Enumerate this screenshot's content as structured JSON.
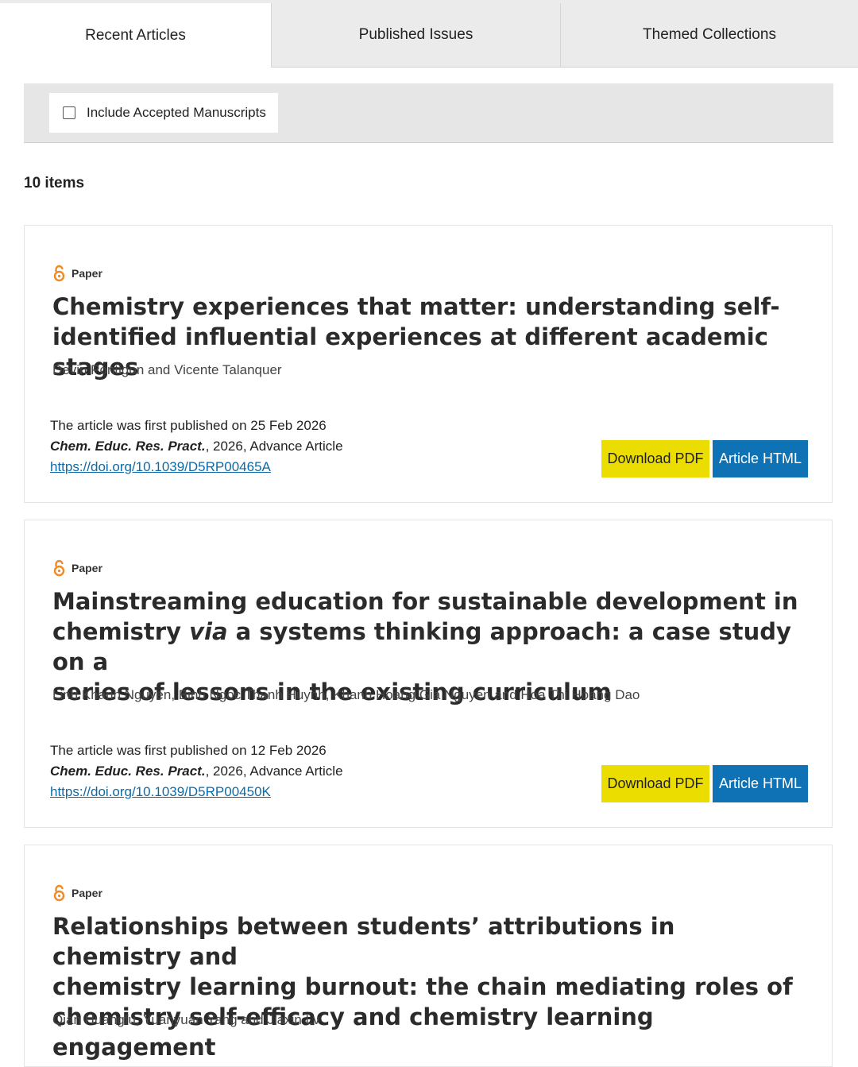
{
  "tabs": [
    {
      "label": "Recent Articles",
      "active": true
    },
    {
      "label": "Published Issues",
      "active": false
    },
    {
      "label": "Themed Collections",
      "active": false
    }
  ],
  "filter": {
    "label": "Include Accepted Manuscripts",
    "checked": false
  },
  "count_label": "10 items",
  "colors": {
    "pdf_button": "#ecdd00",
    "html_button": "#0f72b5",
    "open_access_icon": "#f08a24"
  },
  "articles": [
    {
      "type": "Paper",
      "title_lines": [
        "Chemistry experiences that matter: understanding self-",
        "identified influential experiences at different academic stages"
      ],
      "authors": "Devin Pontigon and Vicente Talanquer",
      "published": "The article was first published on 25 Feb 2026",
      "journal": "Chem. Educ. Res. Pract.",
      "citation_rest": ", 2026, Advance Article",
      "doi": "https://doi.org/10.1039/D5RP00465A",
      "pdf_label": "Download PDF",
      "html_label": "Article HTML"
    },
    {
      "type": "Paper",
      "title_line1": "Mainstreaming education for sustainable development in",
      "title_line2_a": "chemistry ",
      "title_line2_italic": "via",
      "title_line2_b": " a systems thinking approach: a case study on a",
      "title_line3": "series of lessons in the existing curriculum",
      "authors": "Linh Khanh Nguyen, Binh Ngoc Thanh Huynh, Khanh Hoang Gia Nguyen and Hoa Thi Hoang Dao",
      "published": "The article was first published on 12 Feb 2026",
      "journal": "Chem. Educ. Res. Pract.",
      "citation_rest": ", 2026, Advance Article",
      "doi": "https://doi.org/10.1039/D5RP00450K",
      "pdf_label": "Download PDF",
      "html_label": "Article HTML"
    },
    {
      "type": "Paper",
      "title_lines": [
        "Relationships between students’ attributions in chemistry and",
        "chemistry learning burnout: the chain mediating roles of",
        "chemistry self-efficacy and chemistry learning engagement"
      ],
      "authors": "Qian Huangfu, Yuanyuan Yang and Jiaxin Lv"
    }
  ]
}
